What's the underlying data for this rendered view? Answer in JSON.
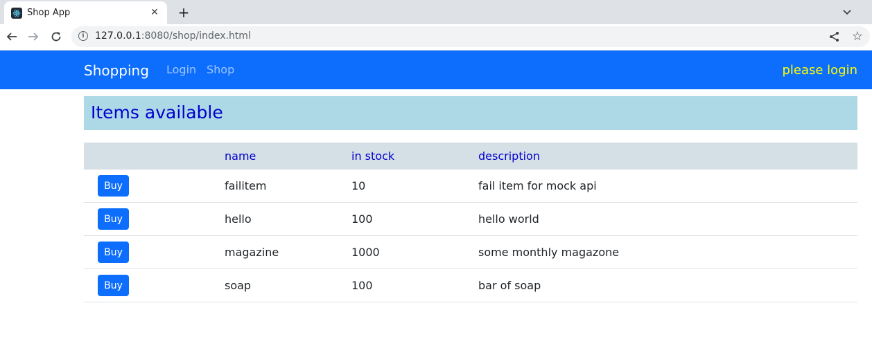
{
  "browser": {
    "tab_title": "Shop App",
    "tab_close": "✕",
    "new_tab": "+",
    "url_host": "127.0.0.1",
    "url_rest": ":8080/shop/index.html"
  },
  "navbar": {
    "brand": "Shopping",
    "links": [
      "Login",
      "Shop"
    ],
    "status": "please login"
  },
  "header": {
    "title": "Items available"
  },
  "table": {
    "columns": [
      "",
      "name",
      "in stock",
      "description"
    ],
    "buy_label": "Buy",
    "rows": [
      {
        "name": "failitem",
        "stock": "10",
        "description": "fail item for mock api"
      },
      {
        "name": "hello",
        "stock": "100",
        "description": "hello world"
      },
      {
        "name": "magazine",
        "stock": "1000",
        "description": "some monthly magazone"
      },
      {
        "name": "soap",
        "stock": "100",
        "description": "bar of soap"
      }
    ]
  },
  "colors": {
    "navbar": "#0d6efd",
    "status_text": "#ffff00",
    "banner": "#add8e6",
    "accent_text": "#0000cd"
  }
}
